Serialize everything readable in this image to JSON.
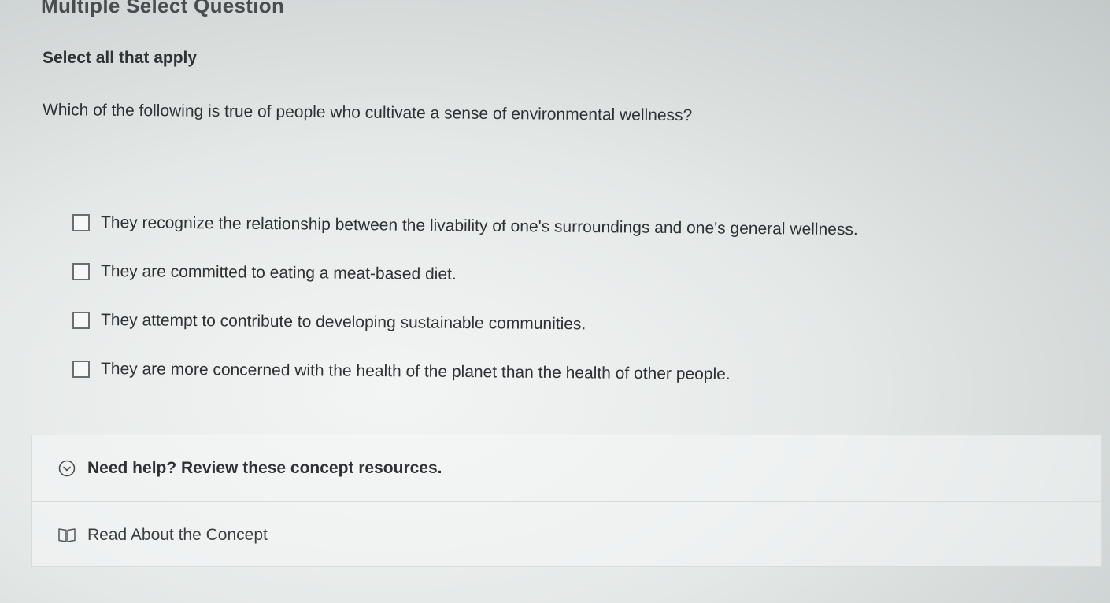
{
  "header": {
    "title": "Multiple Select Question"
  },
  "instruction": "Select all that apply",
  "question": "Which of the following is true of people who cultivate a sense of environmental wellness?",
  "options": [
    {
      "label": "They recognize the relationship between the livability of one's surroundings and one's general wellness.",
      "checked": false
    },
    {
      "label": "They are committed to eating a meat-based diet.",
      "checked": false
    },
    {
      "label": "They attempt to contribute to developing sustainable communities.",
      "checked": false
    },
    {
      "label": "They are more concerned with the health of the planet than the health of other people.",
      "checked": false
    }
  ],
  "help": {
    "toggle_label": "Need help? Review these concept resources.",
    "toggle_icon": "chevron-down-circle-icon",
    "resources": [
      {
        "label": "Read About the Concept",
        "icon": "book-icon"
      }
    ]
  },
  "colors": {
    "text": "#2f3234",
    "checkbox_border": "#6a6e70",
    "panel_border": "#d7dcdb"
  }
}
